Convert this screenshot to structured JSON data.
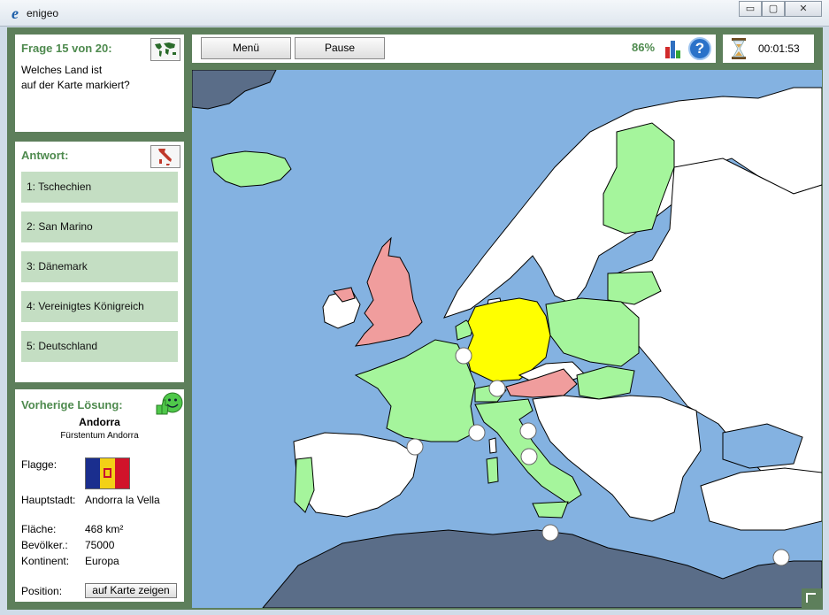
{
  "window": {
    "title": "enigeo",
    "icon_letter": "e",
    "minimize": "▭",
    "restore": "▢",
    "close": "✕"
  },
  "question": {
    "header": "Frage 15 von 20:",
    "text_line1": "Welches Land ist",
    "text_line2": "auf der Karte markiert?"
  },
  "answers": {
    "header": "Antwort:",
    "items": [
      {
        "label": "1: Tschechien"
      },
      {
        "label": "2: San Marino"
      },
      {
        "label": "3: Dänemark"
      },
      {
        "label": "4: Vereinigtes Königreich"
      },
      {
        "label": "5: Deutschland"
      }
    ]
  },
  "solution": {
    "header": "Vorherige Lösung:",
    "name": "Andorra",
    "official_name": "Fürstentum Andorra",
    "flag_label": "Flagge:",
    "capital_label": "Hauptstadt:",
    "capital": "Andorra la Vella",
    "area_label": "Fläche:",
    "area": "468 km²",
    "population_label": "Bevölker.:",
    "population": "75000",
    "continent_label": "Kontinent:",
    "continent": "Europa",
    "position_label": "Position:",
    "show_on_map": "auf Karte zeigen"
  },
  "toolbar": {
    "menu": "Menü",
    "pause": "Pause",
    "score": "86%",
    "help": "?"
  },
  "timer": {
    "time": "00:01:53"
  },
  "icons": {
    "world_map": "world-map-icon",
    "italy": "italy-map-icon",
    "thumbs_up": "thumbs-up-smiley-icon",
    "stats": "bar-chart-icon",
    "help": "help-icon",
    "hourglass": "hourglass-icon"
  },
  "colors": {
    "frame": "#5d7f5b",
    "accent_text": "#4e8a4e",
    "answer_bg": "#c4dec3",
    "sea": "#84b2e1",
    "highlight": "#ffff00",
    "answered_correct": "#a5f59c",
    "answered_wrong": "#f09d9d",
    "unasked": "#ffffff",
    "outside": "#5a6d88"
  }
}
